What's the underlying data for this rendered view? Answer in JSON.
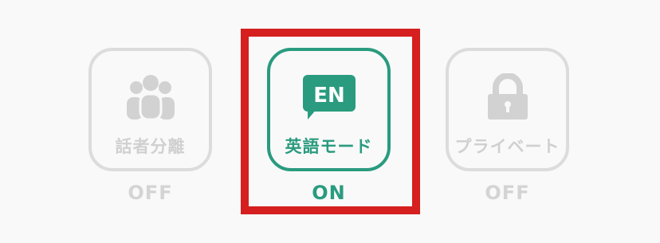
{
  "toggles": [
    {
      "label": "話者分離",
      "status": "OFF",
      "icon": "people-icon"
    },
    {
      "label": "英語モード",
      "status": "ON",
      "icon": "english-mode-icon",
      "badge": "EN"
    },
    {
      "label": "プライベート",
      "status": "OFF",
      "icon": "lock-icon"
    }
  ],
  "colors": {
    "accent": "#2a9b7f",
    "inactive": "#d0d0d0",
    "highlight": "#d61f1f"
  }
}
